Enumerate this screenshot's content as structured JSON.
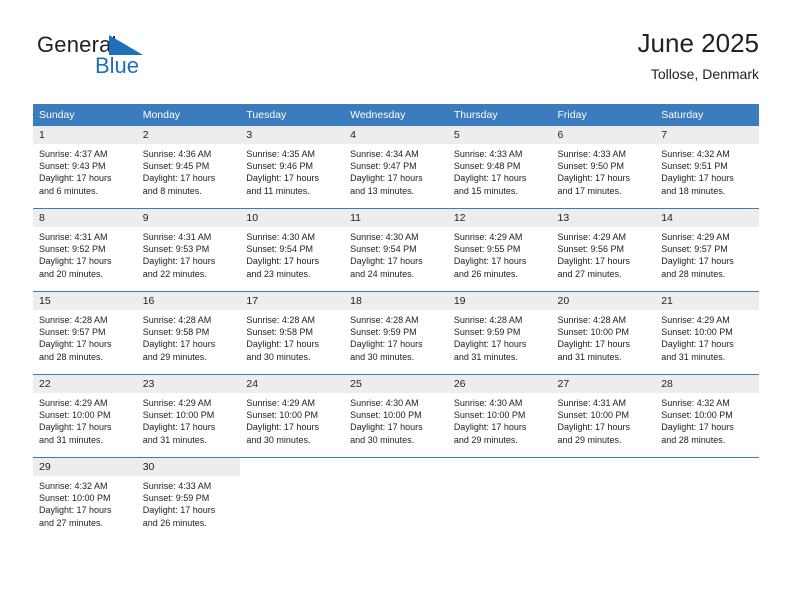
{
  "logo": {
    "text_primary": "General",
    "text_secondary": "Blue",
    "icon": "triangle-flag-icon",
    "color_primary": "#231f20",
    "color_secondary": "#1e71b8"
  },
  "header": {
    "title": "June 2025",
    "subtitle": "Tollose, Denmark"
  },
  "theme": {
    "header_bg": "#3a7cbe",
    "daynum_bg": "#ededed",
    "text": "#222222"
  },
  "weekday_headers": [
    "Sunday",
    "Monday",
    "Tuesday",
    "Wednesday",
    "Thursday",
    "Friday",
    "Saturday"
  ],
  "weeks": [
    [
      {
        "day": "1",
        "sunrise": "Sunrise: 4:37 AM",
        "sunset": "Sunset: 9:43 PM",
        "daylight_line1": "Daylight: 17 hours",
        "daylight_line2": "and 6 minutes."
      },
      {
        "day": "2",
        "sunrise": "Sunrise: 4:36 AM",
        "sunset": "Sunset: 9:45 PM",
        "daylight_line1": "Daylight: 17 hours",
        "daylight_line2": "and 8 minutes."
      },
      {
        "day": "3",
        "sunrise": "Sunrise: 4:35 AM",
        "sunset": "Sunset: 9:46 PM",
        "daylight_line1": "Daylight: 17 hours",
        "daylight_line2": "and 11 minutes."
      },
      {
        "day": "4",
        "sunrise": "Sunrise: 4:34 AM",
        "sunset": "Sunset: 9:47 PM",
        "daylight_line1": "Daylight: 17 hours",
        "daylight_line2": "and 13 minutes."
      },
      {
        "day": "5",
        "sunrise": "Sunrise: 4:33 AM",
        "sunset": "Sunset: 9:48 PM",
        "daylight_line1": "Daylight: 17 hours",
        "daylight_line2": "and 15 minutes."
      },
      {
        "day": "6",
        "sunrise": "Sunrise: 4:33 AM",
        "sunset": "Sunset: 9:50 PM",
        "daylight_line1": "Daylight: 17 hours",
        "daylight_line2": "and 17 minutes."
      },
      {
        "day": "7",
        "sunrise": "Sunrise: 4:32 AM",
        "sunset": "Sunset: 9:51 PM",
        "daylight_line1": "Daylight: 17 hours",
        "daylight_line2": "and 18 minutes."
      }
    ],
    [
      {
        "day": "8",
        "sunrise": "Sunrise: 4:31 AM",
        "sunset": "Sunset: 9:52 PM",
        "daylight_line1": "Daylight: 17 hours",
        "daylight_line2": "and 20 minutes."
      },
      {
        "day": "9",
        "sunrise": "Sunrise: 4:31 AM",
        "sunset": "Sunset: 9:53 PM",
        "daylight_line1": "Daylight: 17 hours",
        "daylight_line2": "and 22 minutes."
      },
      {
        "day": "10",
        "sunrise": "Sunrise: 4:30 AM",
        "sunset": "Sunset: 9:54 PM",
        "daylight_line1": "Daylight: 17 hours",
        "daylight_line2": "and 23 minutes."
      },
      {
        "day": "11",
        "sunrise": "Sunrise: 4:30 AM",
        "sunset": "Sunset: 9:54 PM",
        "daylight_line1": "Daylight: 17 hours",
        "daylight_line2": "and 24 minutes."
      },
      {
        "day": "12",
        "sunrise": "Sunrise: 4:29 AM",
        "sunset": "Sunset: 9:55 PM",
        "daylight_line1": "Daylight: 17 hours",
        "daylight_line2": "and 26 minutes."
      },
      {
        "day": "13",
        "sunrise": "Sunrise: 4:29 AM",
        "sunset": "Sunset: 9:56 PM",
        "daylight_line1": "Daylight: 17 hours",
        "daylight_line2": "and 27 minutes."
      },
      {
        "day": "14",
        "sunrise": "Sunrise: 4:29 AM",
        "sunset": "Sunset: 9:57 PM",
        "daylight_line1": "Daylight: 17 hours",
        "daylight_line2": "and 28 minutes."
      }
    ],
    [
      {
        "day": "15",
        "sunrise": "Sunrise: 4:28 AM",
        "sunset": "Sunset: 9:57 PM",
        "daylight_line1": "Daylight: 17 hours",
        "daylight_line2": "and 28 minutes."
      },
      {
        "day": "16",
        "sunrise": "Sunrise: 4:28 AM",
        "sunset": "Sunset: 9:58 PM",
        "daylight_line1": "Daylight: 17 hours",
        "daylight_line2": "and 29 minutes."
      },
      {
        "day": "17",
        "sunrise": "Sunrise: 4:28 AM",
        "sunset": "Sunset: 9:58 PM",
        "daylight_line1": "Daylight: 17 hours",
        "daylight_line2": "and 30 minutes."
      },
      {
        "day": "18",
        "sunrise": "Sunrise: 4:28 AM",
        "sunset": "Sunset: 9:59 PM",
        "daylight_line1": "Daylight: 17 hours",
        "daylight_line2": "and 30 minutes."
      },
      {
        "day": "19",
        "sunrise": "Sunrise: 4:28 AM",
        "sunset": "Sunset: 9:59 PM",
        "daylight_line1": "Daylight: 17 hours",
        "daylight_line2": "and 31 minutes."
      },
      {
        "day": "20",
        "sunrise": "Sunrise: 4:28 AM",
        "sunset": "Sunset: 10:00 PM",
        "daylight_line1": "Daylight: 17 hours",
        "daylight_line2": "and 31 minutes."
      },
      {
        "day": "21",
        "sunrise": "Sunrise: 4:29 AM",
        "sunset": "Sunset: 10:00 PM",
        "daylight_line1": "Daylight: 17 hours",
        "daylight_line2": "and 31 minutes."
      }
    ],
    [
      {
        "day": "22",
        "sunrise": "Sunrise: 4:29 AM",
        "sunset": "Sunset: 10:00 PM",
        "daylight_line1": "Daylight: 17 hours",
        "daylight_line2": "and 31 minutes."
      },
      {
        "day": "23",
        "sunrise": "Sunrise: 4:29 AM",
        "sunset": "Sunset: 10:00 PM",
        "daylight_line1": "Daylight: 17 hours",
        "daylight_line2": "and 31 minutes."
      },
      {
        "day": "24",
        "sunrise": "Sunrise: 4:29 AM",
        "sunset": "Sunset: 10:00 PM",
        "daylight_line1": "Daylight: 17 hours",
        "daylight_line2": "and 30 minutes."
      },
      {
        "day": "25",
        "sunrise": "Sunrise: 4:30 AM",
        "sunset": "Sunset: 10:00 PM",
        "daylight_line1": "Daylight: 17 hours",
        "daylight_line2": "and 30 minutes."
      },
      {
        "day": "26",
        "sunrise": "Sunrise: 4:30 AM",
        "sunset": "Sunset: 10:00 PM",
        "daylight_line1": "Daylight: 17 hours",
        "daylight_line2": "and 29 minutes."
      },
      {
        "day": "27",
        "sunrise": "Sunrise: 4:31 AM",
        "sunset": "Sunset: 10:00 PM",
        "daylight_line1": "Daylight: 17 hours",
        "daylight_line2": "and 29 minutes."
      },
      {
        "day": "28",
        "sunrise": "Sunrise: 4:32 AM",
        "sunset": "Sunset: 10:00 PM",
        "daylight_line1": "Daylight: 17 hours",
        "daylight_line2": "and 28 minutes."
      }
    ],
    [
      {
        "day": "29",
        "sunrise": "Sunrise: 4:32 AM",
        "sunset": "Sunset: 10:00 PM",
        "daylight_line1": "Daylight: 17 hours",
        "daylight_line2": "and 27 minutes."
      },
      {
        "day": "30",
        "sunrise": "Sunrise: 4:33 AM",
        "sunset": "Sunset: 9:59 PM",
        "daylight_line1": "Daylight: 17 hours",
        "daylight_line2": "and 26 minutes."
      },
      null,
      null,
      null,
      null,
      null
    ]
  ]
}
